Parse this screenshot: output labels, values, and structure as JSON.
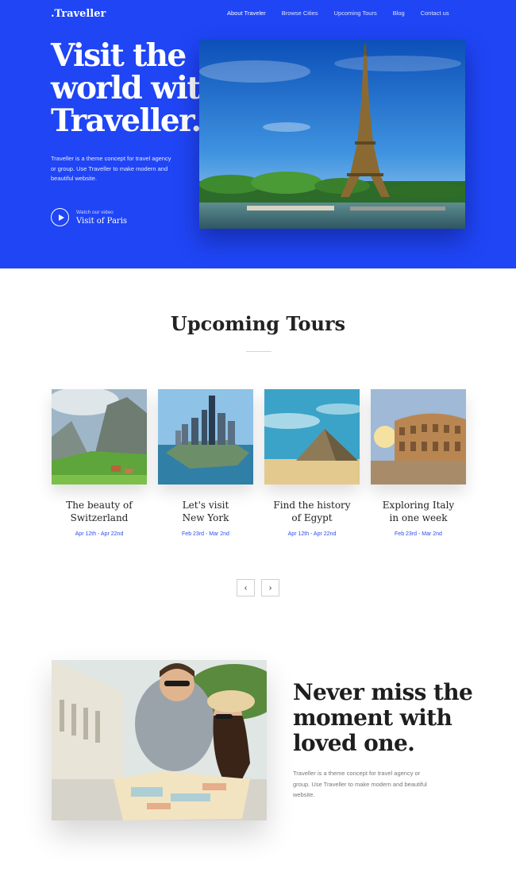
{
  "brand": {
    "logo": ".Traveller"
  },
  "nav": {
    "items": [
      "About Traveler",
      "Browse Cities",
      "Upcoming Tours",
      "Blog",
      "Contact us"
    ]
  },
  "hero": {
    "title": "Visit the world with Traveller.",
    "description": "Traveller is a theme concept for travel agency or group. Use Traveller to make modern and beautiful website.",
    "video_caption": "Watch our video",
    "video_title": "Visit of Paris"
  },
  "upcoming": {
    "title": "Upcoming Tours",
    "tours": [
      {
        "title_line1": "The beauty of",
        "title_line2": "Switzerland",
        "dates": "Apr 12th - Apr 22nd"
      },
      {
        "title_line1": "Let's visit",
        "title_line2": "New York",
        "dates": "Feb 23rd - Mar 2nd"
      },
      {
        "title_line1": "Find the history",
        "title_line2": "of Egypt",
        "dates": "Apr 12th - Apr 22nd"
      },
      {
        "title_line1": "Exploring Italy",
        "title_line2": "in one week",
        "dates": "Feb 23rd - Mar 2nd"
      }
    ],
    "prev_symbol": "‹",
    "next_symbol": "›"
  },
  "feature": {
    "title": "Never miss the moment with loved one.",
    "description": "Traveller is a theme concept for travel agency or group. Use Traveller to make modern and beautiful website."
  },
  "colors": {
    "hero_background": "#1f45f5",
    "accent_date": "#2c4ef0",
    "heading": "#222222"
  }
}
